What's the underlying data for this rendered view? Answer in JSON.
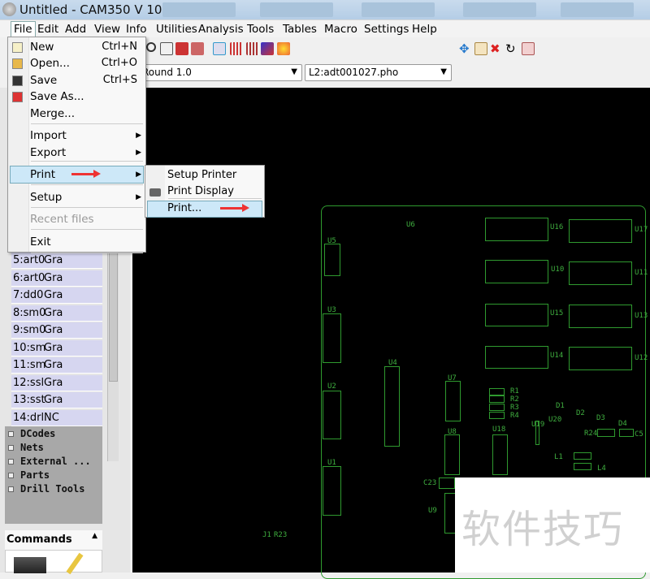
{
  "window": {
    "title": "Untitled - CAM350 V 10.0"
  },
  "menubar": [
    "File",
    "Edit",
    "Add",
    "View",
    "Info",
    "Utilities",
    "Analysis",
    "Tools",
    "Tables",
    "Macro",
    "Settings",
    "Help"
  ],
  "combos": {
    "aperture": "Round 1.0",
    "layer": "L2:adt001027.pho"
  },
  "file_menu": {
    "items": [
      {
        "label": "New",
        "shortcut": "Ctrl+N"
      },
      {
        "label": "Open...",
        "shortcut": "Ctrl+O"
      },
      {
        "label": "Save",
        "shortcut": "Ctrl+S"
      },
      {
        "label": "Save As...",
        "shortcut": ""
      },
      {
        "label": "Merge...",
        "shortcut": ""
      },
      {
        "label": "Import",
        "shortcut": ""
      },
      {
        "label": "Export",
        "shortcut": ""
      },
      {
        "label": "Print",
        "shortcut": ""
      },
      {
        "label": "Setup",
        "shortcut": ""
      },
      {
        "label": "Recent files",
        "shortcut": ""
      },
      {
        "label": "Exit",
        "shortcut": ""
      }
    ],
    "highlighted": "Print"
  },
  "print_menu": {
    "items": [
      "Setup Printer",
      "Print Display",
      "Print..."
    ],
    "highlighted": "Print..."
  },
  "layers": [
    [
      "5:art0",
      "Gra"
    ],
    [
      "6:art0",
      "Gra"
    ],
    [
      "7:dd0",
      "Gra"
    ],
    [
      "8:sm0",
      "Gra"
    ],
    [
      "9:sm0",
      "Gra"
    ],
    [
      "10:sm",
      "Gra"
    ],
    [
      "11:sm",
      "Gra"
    ],
    [
      "12:ssl",
      "Gra"
    ],
    [
      "13:sst",
      "Gra"
    ],
    [
      "14:drl",
      "NC"
    ]
  ],
  "tree": [
    "DCodes",
    "Nets",
    "External ...",
    "Parts",
    "Drill Tools"
  ],
  "commands_title": "Commands",
  "pcb_labels": [
    "U6",
    "U5",
    "U3",
    "U2",
    "U1",
    "U4",
    "U7",
    "U8",
    "U9",
    "U18",
    "U19",
    "U20",
    "U16",
    "U17",
    "U10",
    "U11",
    "U15",
    "U13",
    "U14",
    "U12",
    "R1",
    "R2",
    "R3",
    "R4",
    "D1",
    "D2",
    "D3",
    "D4",
    "R24",
    "C5",
    "L1",
    "L4",
    "C23",
    "J1",
    "R23"
  ],
  "watermark": "软件技巧",
  "colors": {
    "pcb_outline": "#2f9a2f",
    "canvas": "#000000",
    "highlight": "#cde8f8",
    "arrow": "#e33333"
  }
}
